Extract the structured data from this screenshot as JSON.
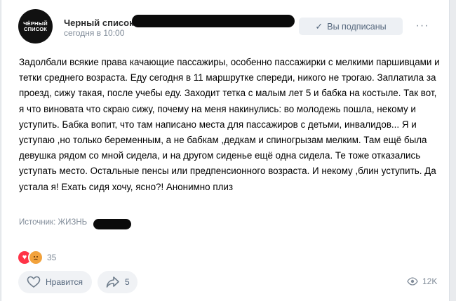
{
  "post": {
    "avatar_text": "ЧЁРНЫЙ\nСПИСОК",
    "author": "Черный список",
    "date": "сегодня в 10:00",
    "subscribe_label": "Вы подписаны",
    "more_label": "···",
    "text": "Задолбали всякие права качающие пассажиры, особенно пассажирки с мелкими паршивцами и тетки среднего возраста. Еду сегодня в 11 маршрутке спереди, никого не трогаю. Заплатила за проезд, сижу такая, после учебы еду. Заходит тетка с малым лет 5 и бабка на костыле. Так вот, я что виновата что скраю сижу, почему на меня накинулись: во молодежь пошла, некому и уступить. Бабка вопит, что там написано места для пассажиров с детьми, инвалидов... Я и уступаю ,но только беременным, а не бабкам ,дедкам и спиногрызам мелким. Там ещё была девушка рядом со мной сидела, и на другом сиденье ещё одна сидела. Те тоже отказались уступать место. Остальные пенсы или предпенсионного возраста. И некому ,блин уступить. Да устала я! Ехать сидя хочу, ясно?! Анонимно плиз",
    "source": "Источник: ЖИЗНЬ"
  },
  "footer": {
    "reactions_count": "35",
    "like_label": "Нравится",
    "share_count": "5",
    "views": "12K"
  },
  "icons": {
    "subscribed": "check-icon",
    "more": "more-dots-icon",
    "like": "heart-outline-icon",
    "share": "share-arrow-icon",
    "views": "eye-icon",
    "reaction1": "heart-emoji-icon",
    "reaction2": "angry-emoji-icon"
  },
  "colors": {
    "link": "#2a5885",
    "muted": "#818c99",
    "button_bg": "#f0f2f5"
  }
}
